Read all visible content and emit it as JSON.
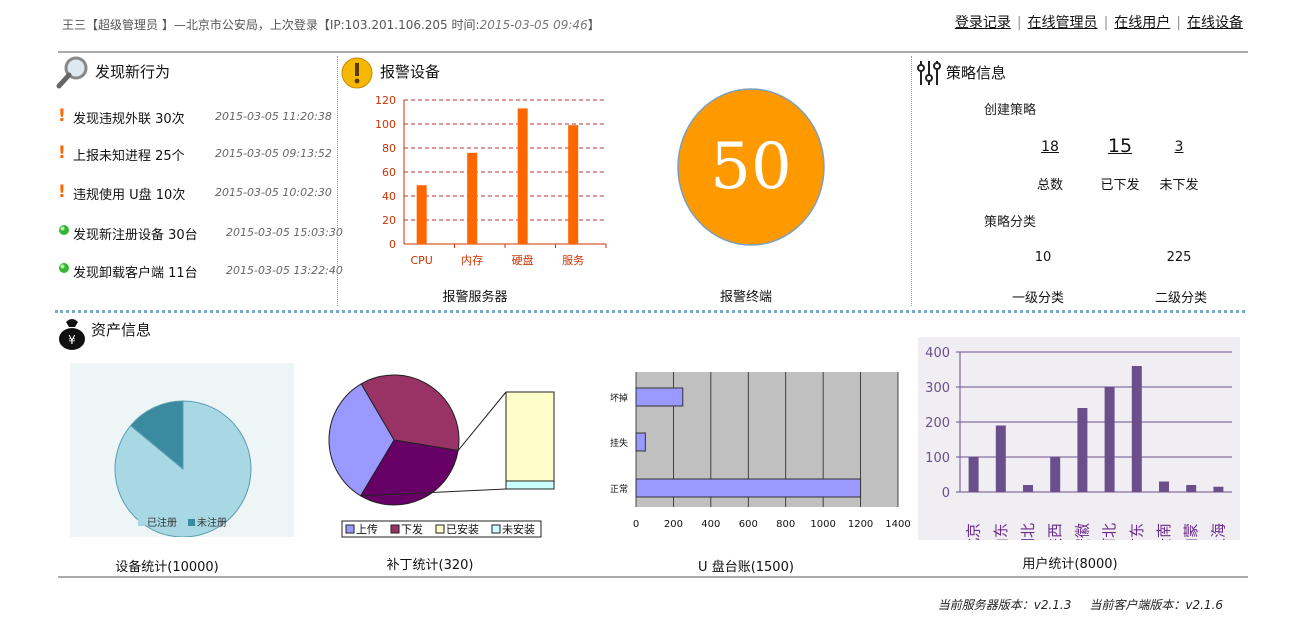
{
  "header": {
    "user_info": "王三【超级管理员 】—北京市公安局，上次登录【IP:103.201.106.205  时间:",
    "login_time": "2015-03-05 09:46",
    "user_info_end": "】",
    "links": [
      "登录记录",
      "在线管理员",
      "在线用户",
      "在线设备"
    ]
  },
  "discover": {
    "title": "发现新行为",
    "items": [
      {
        "text": "发现违规外联 30次",
        "time": "2015-03-05 11:20:38",
        "level": "warn"
      },
      {
        "text": "上报未知进程 25个",
        "time": "2015-03-05 09:13:52",
        "level": "warn"
      },
      {
        "text": "违规使用 U盘 10次",
        "time": "2015-03-05 10:02:30",
        "level": "warn"
      },
      {
        "text": "发现新注册设备 30台",
        "time": "2015-03-05 15:03:30",
        "level": "ok"
      },
      {
        "text": "发现卸载客户端 11台",
        "time": "2015-03-05 13:22:40",
        "level": "ok"
      }
    ]
  },
  "alarm": {
    "title": "报警设备",
    "server_caption": "报警服务器",
    "terminal_caption": "报警终端",
    "terminal_count": "50"
  },
  "strategy": {
    "title": "策略信息",
    "create_label": "创建策略",
    "total_value": "18",
    "total_label": "总数",
    "issued_value": "15",
    "issued_label": "已下发",
    "not_issued_value": "3",
    "not_issued_label": "未下发",
    "category_label": "策略分类",
    "level1_value": "10",
    "level1_label": "一级分类",
    "level2_value": "225",
    "level2_label": "二级分类"
  },
  "assets": {
    "title": "资产信息",
    "device_caption": "设备统计(10000)",
    "patch_caption": "补丁统计(320)",
    "usb_caption": "U 盘台账(1500)",
    "user_caption": "用户统计(8000)"
  },
  "footer": {
    "server_version": "当前服务器版本：v2.1.3",
    "client_version": "当前客户端版本：v2.1.6"
  },
  "colors": {
    "bar_orange": "#ff6600",
    "circle_orange": "#ff9900",
    "pie_light": "#a8d8e4",
    "pie_dark": "#3a8aa0",
    "patch_upload": "#9999ff",
    "patch_issued": "#993366",
    "patch_installed": "#ffffcc",
    "patch_not_installed": "#ccffff",
    "patch_third": "#660066",
    "usb_bar": "#9999ff",
    "user_bar": "#6b4f8c"
  },
  "chart_data": [
    {
      "id": "alarm_servers",
      "type": "bar",
      "categories": [
        "CPU",
        "内存",
        "硬盘",
        "服务"
      ],
      "values": [
        49,
        76,
        113,
        99
      ],
      "ylim": [
        0,
        120
      ],
      "yticks": [
        0,
        20,
        40,
        60,
        80,
        100,
        120
      ],
      "grid": true
    },
    {
      "id": "device_stats",
      "type": "pie",
      "labels": [
        "已注册",
        "未注册"
      ],
      "values": [
        86,
        14
      ],
      "legend": "bottom"
    },
    {
      "id": "patch_stats",
      "type": "pie",
      "labels": [
        "上传",
        "下发",
        "已安装",
        "未安装"
      ],
      "values": [
        36,
        31,
        33
      ],
      "legend": "bottom"
    },
    {
      "id": "usb_ledger",
      "type": "bar",
      "orientation": "horizontal",
      "categories": [
        "坏掉",
        "挂失",
        "正常"
      ],
      "values": [
        250,
        50,
        1200
      ],
      "xlim": [
        0,
        1400
      ],
      "xticks": [
        0,
        200,
        400,
        600,
        800,
        1000,
        1200,
        1400
      ]
    },
    {
      "id": "user_stats",
      "type": "bar",
      "categories": [
        "北京",
        "山东",
        "湖北",
        "陕西",
        "安徽",
        "河北",
        "广东",
        "云南",
        "内蒙",
        "上海"
      ],
      "values": [
        100,
        190,
        20,
        100,
        240,
        300,
        360,
        30,
        20,
        15
      ],
      "ylim": [
        0,
        400
      ],
      "yticks": [
        0,
        100,
        200,
        300,
        400
      ]
    }
  ]
}
